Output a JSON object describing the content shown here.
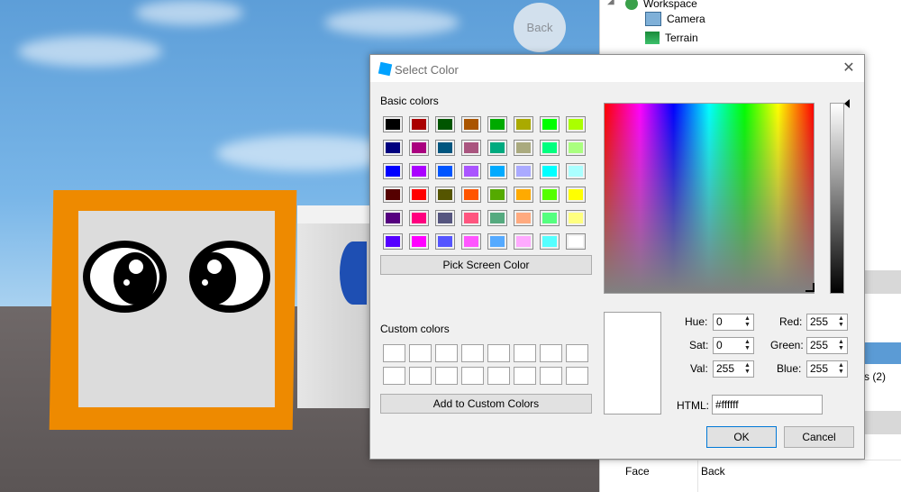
{
  "viewport": {
    "back_label": "Back"
  },
  "explorer": {
    "items": [
      {
        "label": "Workspace"
      },
      {
        "label": "Camera"
      },
      {
        "label": "Terrain"
      }
    ],
    "partial_text": "s (2)",
    "properties": [
      {
        "name": "Face",
        "value": "Back"
      }
    ]
  },
  "dialog": {
    "title": "Select Color",
    "basic_colors_label": "Basic colors",
    "basic_colors": [
      "#000000",
      "#aa0000",
      "#005500",
      "#aa5500",
      "#00aa00",
      "#aaaa00",
      "#00ff00",
      "#aaff00",
      "#00007f",
      "#aa007f",
      "#00557f",
      "#aa557f",
      "#00aa7f",
      "#aaaa7f",
      "#00ff7f",
      "#aaff7f",
      "#0000ff",
      "#aa00ff",
      "#0055ff",
      "#aa55ff",
      "#00aaff",
      "#aaaaff",
      "#00ffff",
      "#aaffff",
      "#550000",
      "#ff0000",
      "#555500",
      "#ff5500",
      "#55aa00",
      "#ffaa00",
      "#55ff00",
      "#ffff00",
      "#55007f",
      "#ff007f",
      "#55557f",
      "#ff557f",
      "#55aa7f",
      "#ffaa7f",
      "#55ff7f",
      "#ffff7f",
      "#5500ff",
      "#ff00ff",
      "#5555ff",
      "#ff55ff",
      "#55aaff",
      "#ffaaff",
      "#55ffff",
      "#ffffff"
    ],
    "pick_screen_label": "Pick Screen Color",
    "custom_colors_label": "Custom colors",
    "add_custom_label": "Add to Custom Colors",
    "fields": {
      "hue": {
        "label": "Hue:",
        "value": "0"
      },
      "sat": {
        "label": "Sat:",
        "value": "0"
      },
      "val": {
        "label": "Val:",
        "value": "255"
      },
      "red": {
        "label": "Red:",
        "value": "255"
      },
      "green": {
        "label": "Green:",
        "value": "255"
      },
      "blue": {
        "label": "Blue:",
        "value": "255"
      }
    },
    "html": {
      "label": "HTML:",
      "value": "#ffffff"
    },
    "ok_label": "OK",
    "cancel_label": "Cancel"
  }
}
